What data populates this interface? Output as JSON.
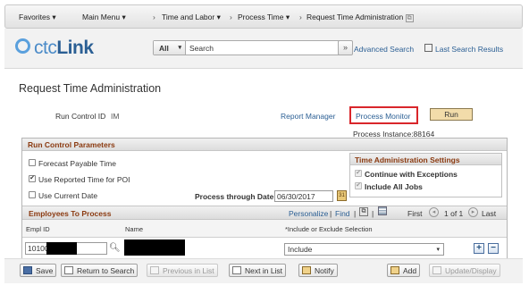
{
  "topnav": {
    "favorites": "Favorites",
    "main_menu": "Main Menu",
    "time_and_labor": "Time and Labor",
    "process_time": "Process Time",
    "request_time_admin": "Request Time Administration"
  },
  "header": {
    "logo_prefix": "ctc",
    "logo_suffix": "Link",
    "search_scope": "All",
    "search_placeholder": "Search",
    "advanced_search": "Advanced Search",
    "last_search_results": "Last Search Results"
  },
  "page": {
    "title": "Request Time Administration",
    "run_control_label": "Run Control ID",
    "run_control_value": "IM",
    "report_manager": "Report Manager",
    "process_monitor": "Process Monitor",
    "run": "Run",
    "process_instance": "Process Instance:88164"
  },
  "run_control": {
    "header": "Run Control Parameters",
    "forecast_payable": {
      "label": "Forecast Payable Time",
      "checked": false
    },
    "use_reported": {
      "label": "Use Reported Time for POI",
      "checked": true
    },
    "use_current_date": {
      "label": "Use Current Date",
      "checked": false
    },
    "process_through_label": "Process through Date",
    "process_through_value": "06/30/2017"
  },
  "tas": {
    "header": "Time Administration Settings",
    "continue_exceptions": {
      "label": "Continue with Exceptions",
      "checked": true
    },
    "include_all_jobs": {
      "label": "Include All Jobs",
      "checked": true
    }
  },
  "employees": {
    "header": "Employees To Process",
    "personalize": "Personalize",
    "find": "Find",
    "first": "First",
    "range": "1 of 1",
    "last": "Last",
    "col_empl_id": "Empl ID",
    "col_name": "Name",
    "col_include": "*Include or Exclude Selection",
    "rows": [
      {
        "empl_id": "10100",
        "include": "Include"
      }
    ]
  },
  "toolbar": {
    "save": "Save",
    "return_to_search": "Return to Search",
    "previous_in_list": "Previous in List",
    "next_in_list": "Next in List",
    "notify": "Notify",
    "add": "Add",
    "update_display": "Update/Display"
  }
}
